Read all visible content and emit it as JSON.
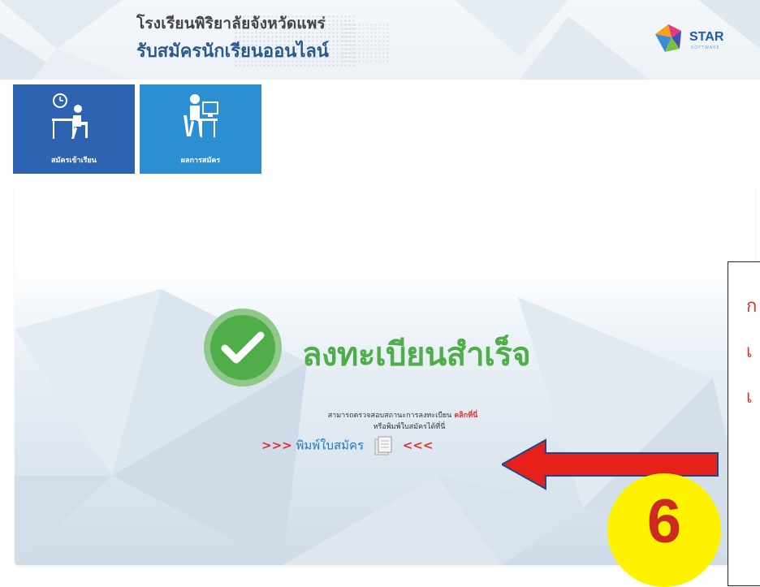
{
  "header": {
    "school_name": "โรงเรียนพิริยาลัยจังหวัดแพร่",
    "site_title": "รับสมัครนักเรียนออนไลน์",
    "logo_text": "STAR",
    "logo_sub": "SOFTWARE"
  },
  "menu": [
    {
      "label": "สมัครเข้าเรียน",
      "icon": "clock-desk-icon"
    },
    {
      "label": "ผลการสมัคร",
      "icon": "person-computer-icon"
    }
  ],
  "result": {
    "title": "ลงทะเบียนสำเร็จ",
    "check_line": "สามารถตรวจสอบสถานะการลงทะเบียน",
    "check_link": "คลิกที่นี่",
    "print_line": "หรือพิมพ์ใบสมัครได้ที่นี่",
    "arrows_left": ">>>",
    "print_label": "พิมพ์ใบสมัคร",
    "arrows_right": "<<<"
  },
  "annotation": {
    "callout_lines": [
      "ก",
      "เ",
      "เ"
    ],
    "step_number": "6"
  },
  "colors": {
    "accent_blue": "#2e63b1",
    "success_green": "#4fae4a",
    "annotation_red": "#e0312f",
    "step_yellow": "#fff200"
  }
}
